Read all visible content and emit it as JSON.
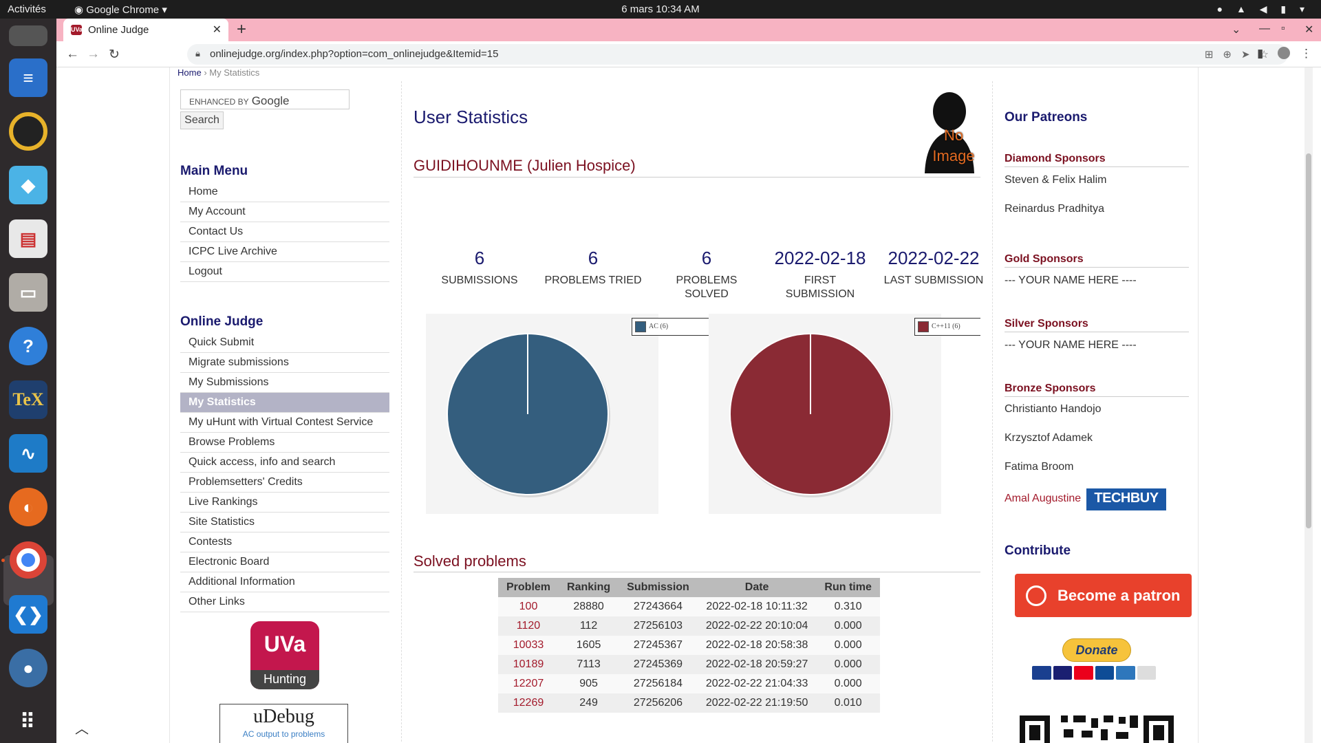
{
  "system": {
    "activities": "Activités",
    "app_name": "Google Chrome",
    "clock": "6 mars  10:34 AM"
  },
  "browser": {
    "tab_title": "Online Judge",
    "url": "onlinejudge.org/index.php?option=com_onlinejudge&Itemid=15"
  },
  "breadcrumb": {
    "home": "Home",
    "current": "My Statistics"
  },
  "search": {
    "google_label": "ENHANCED BY",
    "google_word": "Google",
    "button": "Search"
  },
  "main_menu": {
    "title": "Main Menu",
    "items": [
      "Home",
      "My Account",
      "Contact Us",
      "ICPC Live Archive",
      "Logout"
    ]
  },
  "online_judge": {
    "title": "Online Judge",
    "items": [
      "Quick Submit",
      "Migrate submissions",
      "My Submissions",
      "My Statistics",
      "My uHunt with Virtual Contest Service",
      "Browse Problems",
      "Quick access, info and search",
      "Problemsetters' Credits",
      "Live Rankings",
      "Site Statistics",
      "Contests",
      "Electronic Board",
      "Additional Information",
      "Other Links"
    ],
    "active_index": 3
  },
  "logos": {
    "uva_top": "UVa",
    "uva_bottom": "Hunting",
    "udebug_title": "uDebug",
    "udebug_sub": "AC output to problems"
  },
  "main": {
    "title": "User Statistics",
    "user": "GUIDIHOUNME (Julien Hospice)",
    "avatar_text": "No Image",
    "stats": [
      {
        "value": "6",
        "label": "SUBMISSIONS"
      },
      {
        "value": "6",
        "label": "PROBLEMS TRIED"
      },
      {
        "value": "6",
        "label": "PROBLEMS SOLVED"
      },
      {
        "value": "2022-02-18",
        "label": "FIRST SUBMISSION"
      },
      {
        "value": "2022-02-22",
        "label": "LAST SUBMISSION"
      }
    ],
    "solved_title": "Solved problems",
    "table": {
      "headers": [
        "Problem",
        "Ranking",
        "Submission",
        "Date",
        "Run time"
      ],
      "rows": [
        [
          "100",
          "28880",
          "27243664",
          "2022-02-18 10:11:32",
          "0.310"
        ],
        [
          "1120",
          "112",
          "27256103",
          "2022-02-22 20:10:04",
          "0.000"
        ],
        [
          "10033",
          "1605",
          "27245367",
          "2022-02-18 20:58:38",
          "0.000"
        ],
        [
          "10189",
          "7113",
          "27245369",
          "2022-02-18 20:59:27",
          "0.000"
        ],
        [
          "12207",
          "905",
          "27256184",
          "2022-02-22 21:04:33",
          "0.000"
        ],
        [
          "12269",
          "249",
          "27256206",
          "2022-02-22 21:19:50",
          "0.010"
        ]
      ]
    }
  },
  "chart_data": [
    {
      "type": "pie",
      "categories": [
        "AC (6)"
      ],
      "values": [
        6
      ],
      "legend": "top-right",
      "colors": [
        "#345e7e"
      ]
    },
    {
      "type": "pie",
      "categories": [
        "C++11 (6)"
      ],
      "values": [
        6
      ],
      "legend": "top-right",
      "colors": [
        "#8a2a34"
      ]
    }
  ],
  "sidebar_right": {
    "patreons_title": "Our Patreons",
    "diamond_title": "Diamond Sponsors",
    "diamond": [
      "Steven & Felix Halim",
      "Reinardus Pradhitya"
    ],
    "gold_title": "Gold Sponsors",
    "gold": [
      "--- YOUR NAME HERE ----"
    ],
    "silver_title": "Silver Sponsors",
    "silver": [
      "--- YOUR NAME HERE ----"
    ],
    "bronze_title": "Bronze Sponsors",
    "bronze": [
      "Christianto Handojo",
      "Krzysztof Adamek",
      "Fatima Broom"
    ],
    "amal": "Amal Augustine",
    "techbuy": "TECHBUY",
    "contribute_title": "Contribute",
    "patron_button": "Become a patron",
    "donate_button": "Donate"
  },
  "colors": {
    "accent": "#1a1a6e",
    "brand_red": "#7b1020",
    "pie_ac": "#345e7e",
    "pie_lang": "#8a2a34"
  }
}
